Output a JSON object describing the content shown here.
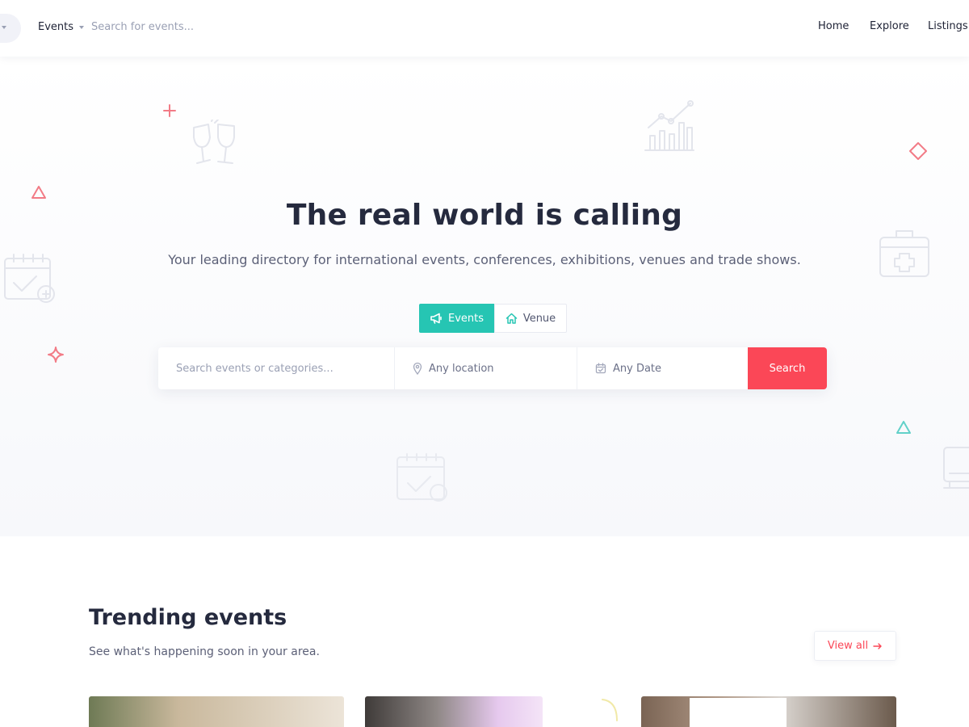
{
  "header": {
    "category_select": "Events",
    "search_placeholder": "Search for events...",
    "nav": [
      "Home",
      "Explore",
      "Listings"
    ]
  },
  "hero": {
    "title": "The real world is calling",
    "subtitle": "Your leading directory for international events, conferences, exhibitions, venues and trade shows.",
    "tabs": [
      {
        "label": "Events",
        "icon": "megaphone-icon",
        "active": true
      },
      {
        "label": "Venue",
        "icon": "home-icon",
        "active": false
      }
    ],
    "search": {
      "keyword_placeholder": "Search events or categories...",
      "location": "Any location",
      "date": "Any Date",
      "button": "Search"
    }
  },
  "trending": {
    "title": "Trending events",
    "subtitle": "See what's happening soon in your area.",
    "view_all": "View all"
  },
  "colors": {
    "accent_teal": "#26c5b3",
    "accent_red": "#fb4757",
    "heading": "#252a3e",
    "muted": "#5c6077"
  }
}
